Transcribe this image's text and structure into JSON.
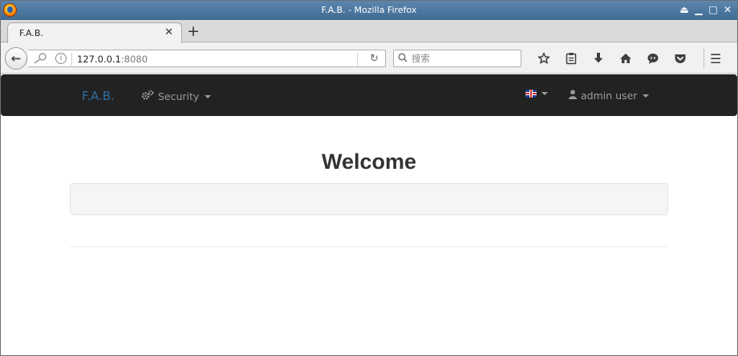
{
  "window": {
    "title": "F.A.B. - Mozilla Firefox",
    "controls": {
      "eject": "⏏",
      "minimize": "▁",
      "maximize": "□",
      "close": "✕"
    }
  },
  "tabs": [
    {
      "label": "F.A.B.",
      "close": "✕"
    }
  ],
  "new_tab": "+",
  "toolbar": {
    "back": "←",
    "url_host": "127.0.0.1",
    "url_port": ":8080",
    "reload": "↻",
    "search_placeholder": "搜索",
    "icons": [
      "star-icon",
      "reading-list-icon",
      "download-icon",
      "home-icon",
      "chat-icon",
      "pocket-icon"
    ],
    "menu": "☰"
  },
  "app": {
    "brand": "F.A.B.",
    "security_menu": "Security",
    "language": "en",
    "user_menu": "admin user",
    "colors": {
      "navbar": "#222222",
      "brand": "#2c6fa5",
      "nav_text": "#9d9d9d"
    }
  },
  "page": {
    "heading": "Welcome"
  }
}
